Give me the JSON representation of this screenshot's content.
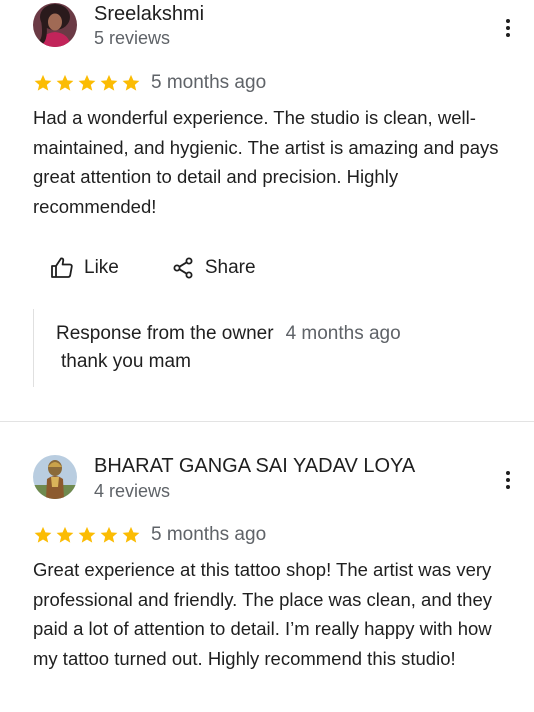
{
  "reviews": [
    {
      "reviewer": "Sreelakshmi",
      "review_count": "5 reviews",
      "rating": 5,
      "date": "5 months ago",
      "text": "Had a wonderful experience. The studio is clean, well-maintained, and hygienic. The artist is amazing and pays great attention to detail and precision. Highly recommended!",
      "actions": {
        "like": "Like",
        "share": "Share"
      },
      "owner_response": {
        "title": "Response from the owner",
        "date": "4 months ago",
        "text": "thank you mam"
      }
    },
    {
      "reviewer": "BHARAT GANGA SAI YADAV LOYA",
      "review_count": "4 reviews",
      "rating": 5,
      "date": "5 months ago",
      "text": "Great experience at this tattoo shop! The artist was very professional and friendly. The place was clean, and they paid a lot of attention to detail. I’m really happy with how my tattoo turned out. Highly recommend this studio!"
    }
  ],
  "colors": {
    "star": "#fbbc04",
    "primary_text": "#1f1f1f",
    "secondary_text": "#5f6368",
    "divider": "#e3e3e3"
  },
  "icons": {
    "like": "thumb-up-icon",
    "share": "share-icon",
    "more": "more-vert-icon",
    "star": "star-icon"
  }
}
